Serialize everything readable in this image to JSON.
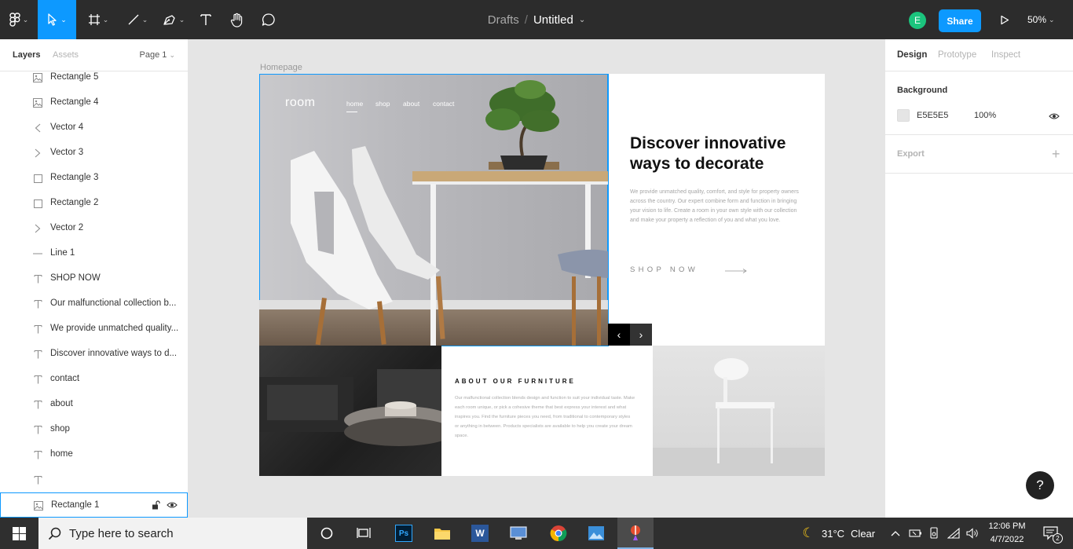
{
  "toolbar": {
    "breadcrumb_drafts": "Drafts",
    "breadcrumb_separator": "/",
    "file_title": "Untitled",
    "avatar_initial": "E",
    "share_label": "Share",
    "zoom_level": "50%",
    "accent_color": "#0d99ff"
  },
  "left_panel": {
    "tab_layers": "Layers",
    "tab_assets": "Assets",
    "page_selector": "Page 1",
    "layers": [
      {
        "name": "Rectangle 5",
        "icon": "image-icon"
      },
      {
        "name": "Rectangle 4",
        "icon": "image-icon"
      },
      {
        "name": "Vector 4",
        "icon": "vector-icon"
      },
      {
        "name": "Vector 3",
        "icon": "vector-icon"
      },
      {
        "name": "Rectangle 3",
        "icon": "rectangle-icon"
      },
      {
        "name": "Rectangle 2",
        "icon": "rectangle-icon"
      },
      {
        "name": "Vector 2",
        "icon": "vector-icon"
      },
      {
        "name": "Line 1",
        "icon": "line-icon"
      },
      {
        "name": "SHOP NOW",
        "icon": "text-icon"
      },
      {
        "name": "Our malfunctional collection b...",
        "icon": "text-icon"
      },
      {
        "name": "We provide unmatched quality...",
        "icon": "text-icon"
      },
      {
        "name": "Discover innovative ways to d...",
        "icon": "text-icon"
      },
      {
        "name": "contact",
        "icon": "text-icon"
      },
      {
        "name": "about",
        "icon": "text-icon"
      },
      {
        "name": "shop",
        "icon": "text-icon"
      },
      {
        "name": "home",
        "icon": "text-icon"
      },
      {
        "name": "",
        "icon": "text-icon"
      },
      {
        "name": "Rectangle 1",
        "icon": "image-icon",
        "selected": true
      }
    ]
  },
  "right_panel": {
    "tab_design": "Design",
    "tab_prototype": "Prototype",
    "tab_inspect": "Inspect",
    "background_label": "Background",
    "background_hex": "E5E5E5",
    "background_opacity": "100%",
    "export_label": "Export",
    "help_label": "?"
  },
  "canvas": {
    "frame_name": "Homepage",
    "logo": "room",
    "nav": [
      "home",
      "shop",
      "about",
      "contact"
    ],
    "headline": "Discover innovative ways to decorate",
    "paragraph": "We provide unmatched quality, comfort, and style for property owners across the country. Our expert combine form and function in bringing your vision to life. Create a room in your own style with our collection and make your property a reflection of you and what you love.",
    "cta": "SHOP NOW",
    "about_title": "ABOUT OUR FURNITURE",
    "about_text": "Our malfunctional collection blends design and function to suit your individual taste. Make each room unique, or pick a cohesive theme that best express your interest and what inspires you. Find the furniture pieces you need, from traditional to contemporary styles or anything in between. Products specialists are available to help you create your dream space."
  },
  "taskbar": {
    "search_placeholder": "Type here to search",
    "weather_temp": "31°C",
    "weather_condition": "Clear",
    "time": "12:06 PM",
    "date": "4/7/2022",
    "notification_count": "2"
  }
}
